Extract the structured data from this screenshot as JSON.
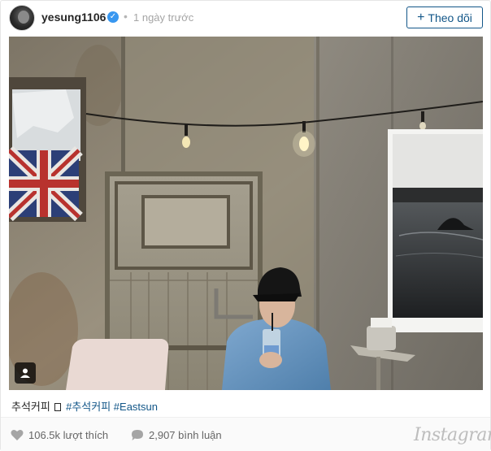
{
  "post": {
    "username": "yesung1106",
    "time_separator": "•",
    "time_ago": "1 ngày trước",
    "follow_label": "Theo dõi",
    "follow_icon": "plus-icon",
    "verified_icon": "verified-badge-icon"
  },
  "caption": {
    "text": "추석커피",
    "emoji_placeholder": "▯",
    "hashtags": [
      "#추석커피",
      "#Eastsun"
    ]
  },
  "footer": {
    "likes": "106.5k lượt thích",
    "comments": "2,907 bình luận",
    "brand": "Instagram",
    "like_icon": "heart-icon",
    "comment_icon": "speech-bubble-icon"
  },
  "colors": {
    "accent": "#125688",
    "verified": "#3897f0",
    "muted": "#a5a5a5"
  }
}
